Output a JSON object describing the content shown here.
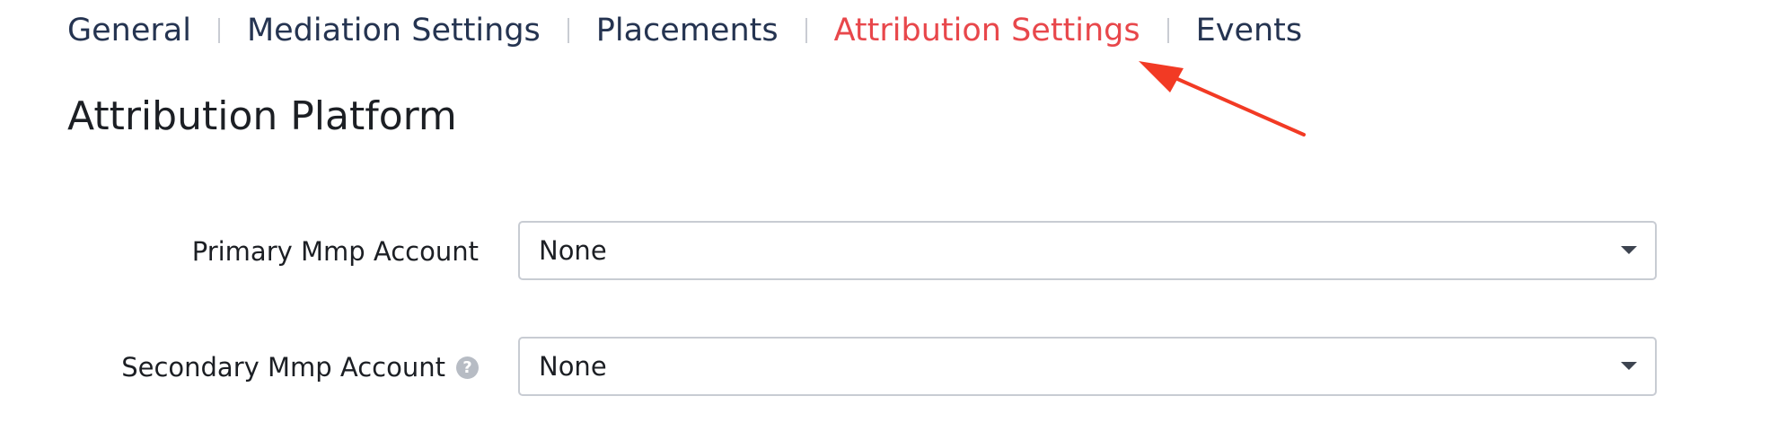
{
  "tabs": [
    {
      "label": "General",
      "active": false
    },
    {
      "label": "Mediation Settings",
      "active": false
    },
    {
      "label": "Placements",
      "active": false
    },
    {
      "label": "Attribution Settings",
      "active": true
    },
    {
      "label": "Events",
      "active": false
    }
  ],
  "section": {
    "title": "Attribution Platform"
  },
  "form": {
    "primary": {
      "label": "Primary Mmp Account",
      "value": "None"
    },
    "secondary": {
      "label": "Secondary Mmp Account",
      "value": "None",
      "help_icon": "question-mark-icon"
    }
  },
  "colors": {
    "tab_text": "#253451",
    "tab_active": "#e8474b",
    "annotation_arrow": "#f23a24",
    "help_icon_bg": "#b7bcc4",
    "select_border": "#c8ccd3"
  },
  "annotation": {
    "icon": "arrow-annotation",
    "points_to": "Attribution Settings"
  }
}
